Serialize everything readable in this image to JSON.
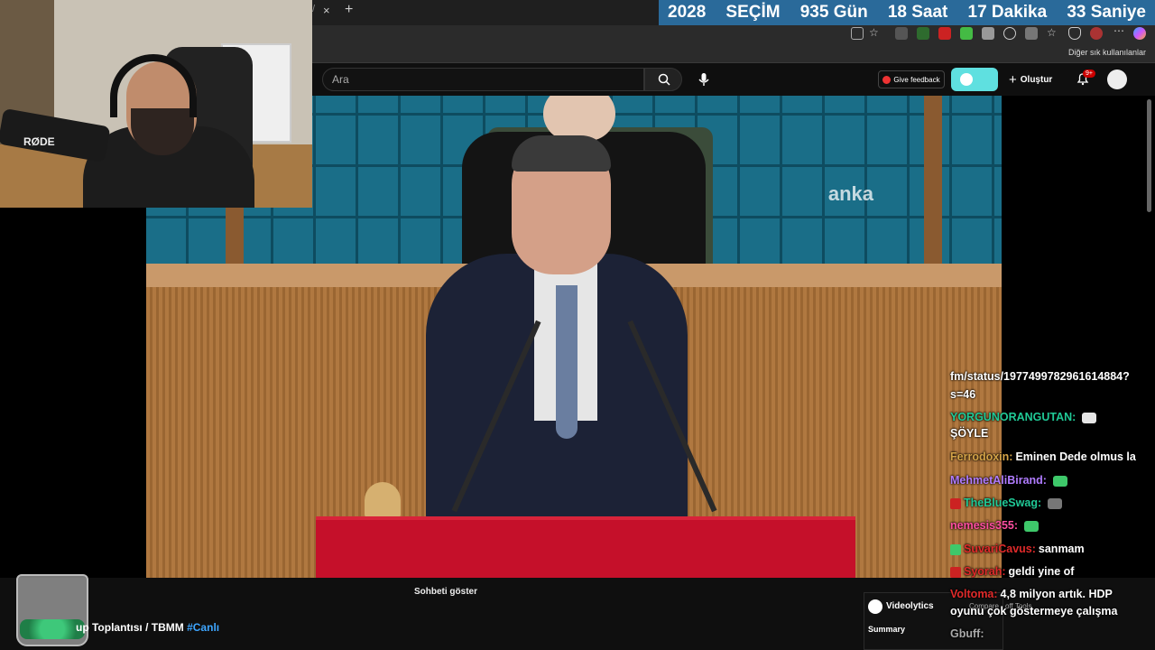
{
  "browser": {
    "tab_close": "×",
    "tab_new": "+",
    "tab_separator": "/",
    "bookmarks_label": "Diğer sık kullanılanlar"
  },
  "countdown": {
    "year": "2028",
    "label": "SEÇİM",
    "days": "935 Gün",
    "hours": "18 Saat",
    "minutes": "17 Dakika",
    "seconds": "33 Saniye"
  },
  "header": {
    "search_placeholder": "Ara",
    "feedback_label": "Give feedback",
    "create_label": "Oluştur",
    "notification_count": "9+"
  },
  "video": {
    "watermark": "anka"
  },
  "webcam": {
    "mic_brand": "RØDE"
  },
  "chat": {
    "messages": [
      {
        "user": "",
        "text": "fm/status/1977499782961614884?",
        "color": "#ffffff"
      },
      {
        "user": "",
        "text": "s=46",
        "color": "#ffffff"
      },
      {
        "user": "YORGUNORANGUTAN:",
        "text": "",
        "color": "#20c996",
        "emote": "#e6e6e6"
      },
      {
        "user": "",
        "text": "ŞÖYLE",
        "color": "#ffffff"
      },
      {
        "user": "Ferrodoxin:",
        "text": "Eminen Dede olmus la",
        "color": "#d4a347"
      },
      {
        "user": "MehmetAliBirand:",
        "text": "",
        "color": "#b07cff",
        "emote": "#3ec86a"
      },
      {
        "user": "TheBlueSwag:",
        "text": "",
        "color": "#20c996",
        "emote": "#777777",
        "badge": "#cc2222"
      },
      {
        "user": "nemesis355:",
        "text": "",
        "color": "#ff4fa0",
        "emote": "#3ec86a"
      },
      {
        "user": "SuvariCavus:",
        "text": "sanmam",
        "color": "#e02a2a",
        "badge": "#3ec86a"
      },
      {
        "user": "Syorah:",
        "text": "geldi yine of",
        "color": "#e02a2a",
        "badge": "#cc2222"
      },
      {
        "user": "Voltoma:",
        "text": "4,8 milyon artık. HDP",
        "color": "#e02a2a"
      },
      {
        "user": "",
        "text": "oyunu çok göstermeye çalışma",
        "color": "#ffffff"
      },
      {
        "user": "Gbuff:",
        "text": "",
        "color": "#aaaaaa"
      }
    ]
  },
  "bottom": {
    "show_chat": "Sohbeti göster",
    "title_text": "up Toplantısı / TBMM ",
    "title_link": "#Canlı",
    "videolytics_title": "Videolytics",
    "videolytics_summary": "Summary",
    "videolytics_hint": "Compare · off    Tools"
  },
  "colors": {
    "countdown_bg": "#2a6a9a",
    "link": "#3ea6ff",
    "accent_pill": "#5fe0e0",
    "podium": "#c5102a"
  }
}
